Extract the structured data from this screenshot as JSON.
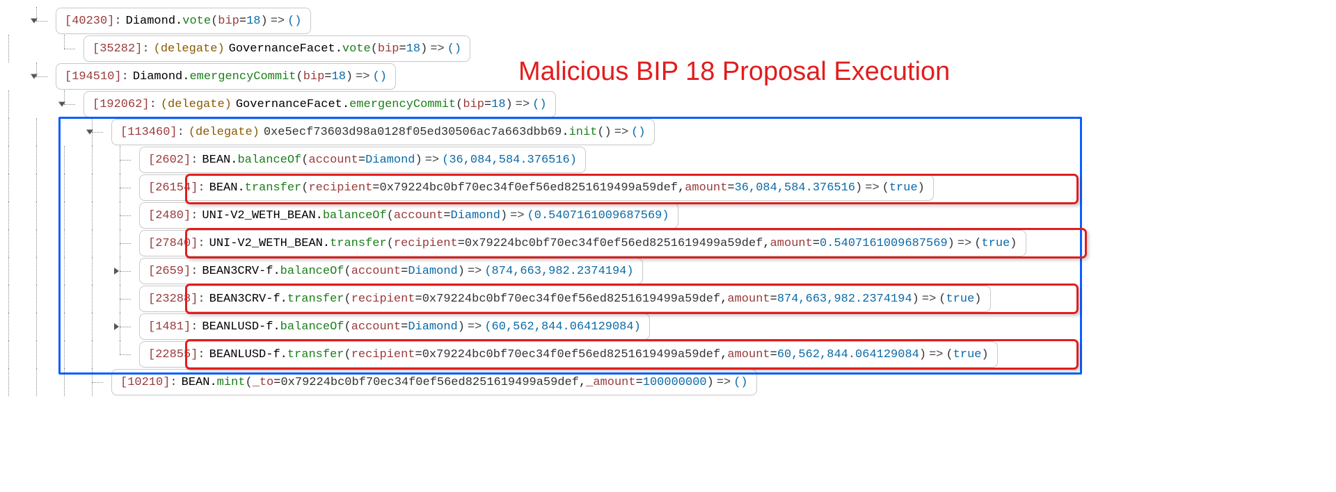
{
  "annotation": "Malicious BIP 18 Proposal Execution",
  "attacker_address": "0x79224bc0bf70ec34f0ef56ed8251619499a59def",
  "init_contract": "0xe5ecf73603d98a0128f05ed30506ac7a663dbb69",
  "lines": {
    "l0": {
      "gas": "[40230]",
      "obj": "Diamond",
      "fn": "vote",
      "argk": "bip",
      "argv": "18",
      "ret": "()"
    },
    "l1": {
      "gas": "[35282]",
      "kw": "(delegate)",
      "obj": "GovernanceFacet",
      "fn": "vote",
      "argk": "bip",
      "argv": "18",
      "ret": "()"
    },
    "l2": {
      "gas": "[194510]",
      "obj": "Diamond",
      "fn": "emergencyCommit",
      "argk": "bip",
      "argv": "18",
      "ret": "()"
    },
    "l3": {
      "gas": "[192062]",
      "kw": "(delegate)",
      "obj": "GovernanceFacet",
      "fn": "emergencyCommit",
      "argk": "bip",
      "argv": "18",
      "ret": "()"
    },
    "l4": {
      "gas": "[113460]",
      "kw": "(delegate)",
      "fn": "init",
      "ret": "()"
    },
    "l5": {
      "gas": "[2602]",
      "obj": "BEAN",
      "fn": "balanceOf",
      "argk": "account",
      "argv": "Diamond",
      "ret": "(36,084,584.376516)"
    },
    "l6": {
      "gas": "[26154]",
      "obj": "BEAN",
      "fn": "transfer",
      "argk1": "recipient",
      "argk2": "amount",
      "argv2": "36,084,584.376516",
      "ret": "(true)"
    },
    "l7": {
      "gas": "[2480]",
      "obj": "UNI-V2_WETH_BEAN",
      "fn": "balanceOf",
      "argk": "account",
      "argv": "Diamond",
      "ret": "(0.5407161009687569)"
    },
    "l8": {
      "gas": "[27840]",
      "obj": "UNI-V2_WETH_BEAN",
      "fn": "transfer",
      "argk1": "recipient",
      "argk2": "amount",
      "argv2": "0.5407161009687569",
      "ret": "(true)"
    },
    "l9": {
      "gas": "[2659]",
      "obj": "BEAN3CRV-f",
      "fn": "balanceOf",
      "argk": "account",
      "argv": "Diamond",
      "ret": "(874,663,982.2374194)"
    },
    "l10": {
      "gas": "[23288]",
      "obj": "BEAN3CRV-f",
      "fn": "transfer",
      "argk1": "recipient",
      "argk2": "amount",
      "argv2": "874,663,982.2374194",
      "ret": "(true)"
    },
    "l11": {
      "gas": "[1481]",
      "obj": "BEANLUSD-f",
      "fn": "balanceOf",
      "argk": "account",
      "argv": "Diamond",
      "ret": "(60,562,844.064129084)"
    },
    "l12": {
      "gas": "[22855]",
      "obj": "BEANLUSD-f",
      "fn": "transfer",
      "argk1": "recipient",
      "argk2": "amount",
      "argv2": "60,562,844.064129084",
      "ret": "(true)"
    },
    "l13": {
      "gas": "[10210]",
      "obj": "BEAN",
      "fn": "mint",
      "argk1": "_to",
      "argk2": "_amount",
      "argv2": "100000000",
      "ret": "()"
    }
  },
  "glyph": {
    "arrow": "=>"
  }
}
